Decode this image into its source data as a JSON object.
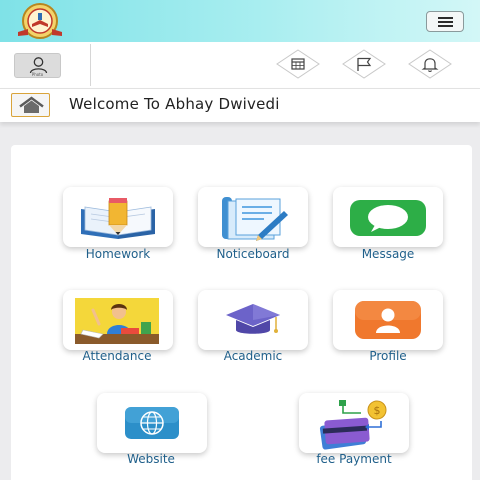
{
  "header": {
    "avatar_label": "Photo"
  },
  "welcome": {
    "text": "Welcome To Abhay Dwivedi"
  },
  "icons": {
    "logo": "school-logo-icon",
    "menu": "hamburger-menu-icon",
    "calendar": "calendar-icon",
    "flag": "flag-icon",
    "bell": "bell-icon",
    "home": "home-icon"
  },
  "tiles": [
    {
      "label": "Homework",
      "icon": "book-pencil-icon"
    },
    {
      "label": "Noticeboard",
      "icon": "notice-document-icon"
    },
    {
      "label": "Message",
      "icon": "chat-bubble-icon"
    },
    {
      "label": "Attendance",
      "icon": "student-desk-icon"
    },
    {
      "label": "Academic",
      "icon": "graduation-cap-icon"
    },
    {
      "label": "Profile",
      "icon": "user-profile-icon"
    },
    {
      "label": "Website",
      "icon": "globe-icon"
    },
    {
      "label": "fee Payment",
      "icon": "card-payment-icon"
    }
  ],
  "colors": {
    "header_gradient_start": "#7fe2e7",
    "header_gradient_end": "#d3f7f7",
    "tile_label": "#1f5f8a",
    "home_border": "#d9a43b"
  }
}
